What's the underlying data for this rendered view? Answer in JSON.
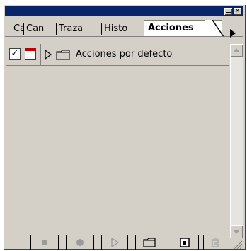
{
  "tabs": [
    {
      "label": "Ca"
    },
    {
      "label": "Can"
    },
    {
      "label": "Traza"
    },
    {
      "label": "Histo"
    }
  ],
  "active_tab": {
    "label": "Acciones"
  },
  "titlebar": {
    "minimize_glyph": "▬",
    "close_glyph": "✕"
  },
  "actions_list": {
    "rows": [
      {
        "label": "Acciones por defecto",
        "checked": true,
        "checkmark": "✓"
      }
    ]
  },
  "bottom_toolbar": {
    "buttons": [
      "stop-icon",
      "record-icon",
      "play-icon",
      "new-set-folder-icon",
      "new-action-icon",
      "trash-icon"
    ]
  }
}
